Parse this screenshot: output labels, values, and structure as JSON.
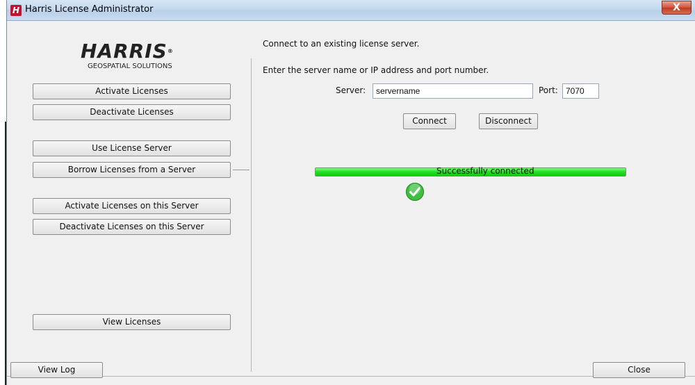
{
  "window": {
    "title": "Harris License Administrator",
    "icon_letter": "H",
    "close_glyph": "X"
  },
  "logo": {
    "word": "HARRIS",
    "registered": "®",
    "subtitle": "GEOSPATIAL SOLUTIONS"
  },
  "sidebar": {
    "activate": "Activate Licenses",
    "deactivate": "Deactivate Licenses",
    "use_server": "Use License Server",
    "borrow": "Borrow Licenses from a Server",
    "activate_server": "Activate Licenses on this Server",
    "deactivate_server": "Deactivate Licenses on this Server",
    "view_licenses": "View Licenses"
  },
  "main": {
    "heading": "Connect to an existing license server.",
    "instruction": "Enter the server name or IP address and port number.",
    "server_label": "Server:",
    "server_value": "servername",
    "port_label": "Port:",
    "port_value": "7070",
    "connect": "Connect",
    "disconnect": "Disconnect",
    "progress_percent": 100,
    "status": "Successfully connected"
  },
  "footer": {
    "view_log": "View Log",
    "close": "Close"
  },
  "colors": {
    "accent_red": "#c8102e",
    "progress_green": "#22dd22",
    "check_green": "#3fbf3f"
  }
}
